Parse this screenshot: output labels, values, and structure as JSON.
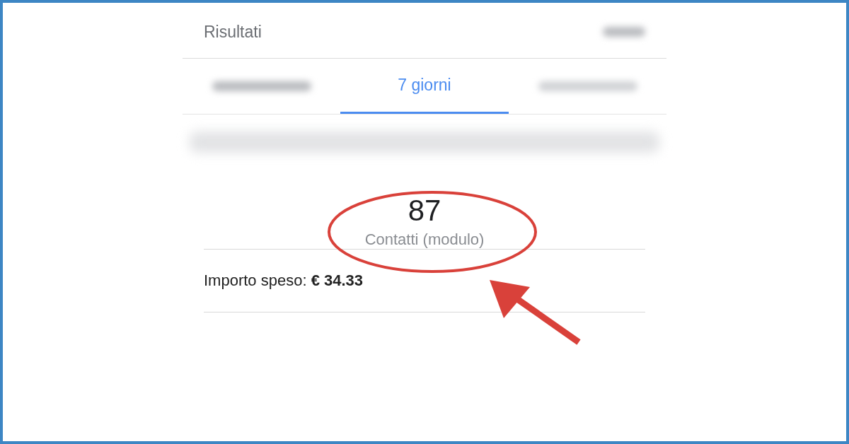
{
  "header": {
    "title": "Risultati"
  },
  "tabs": [
    {
      "label": "7 giorni",
      "selected": true
    }
  ],
  "metric": {
    "value": "87",
    "label": "Contatti (modulo)"
  },
  "spend": {
    "text": "Importo speso: **€ 34.33**"
  }
}
